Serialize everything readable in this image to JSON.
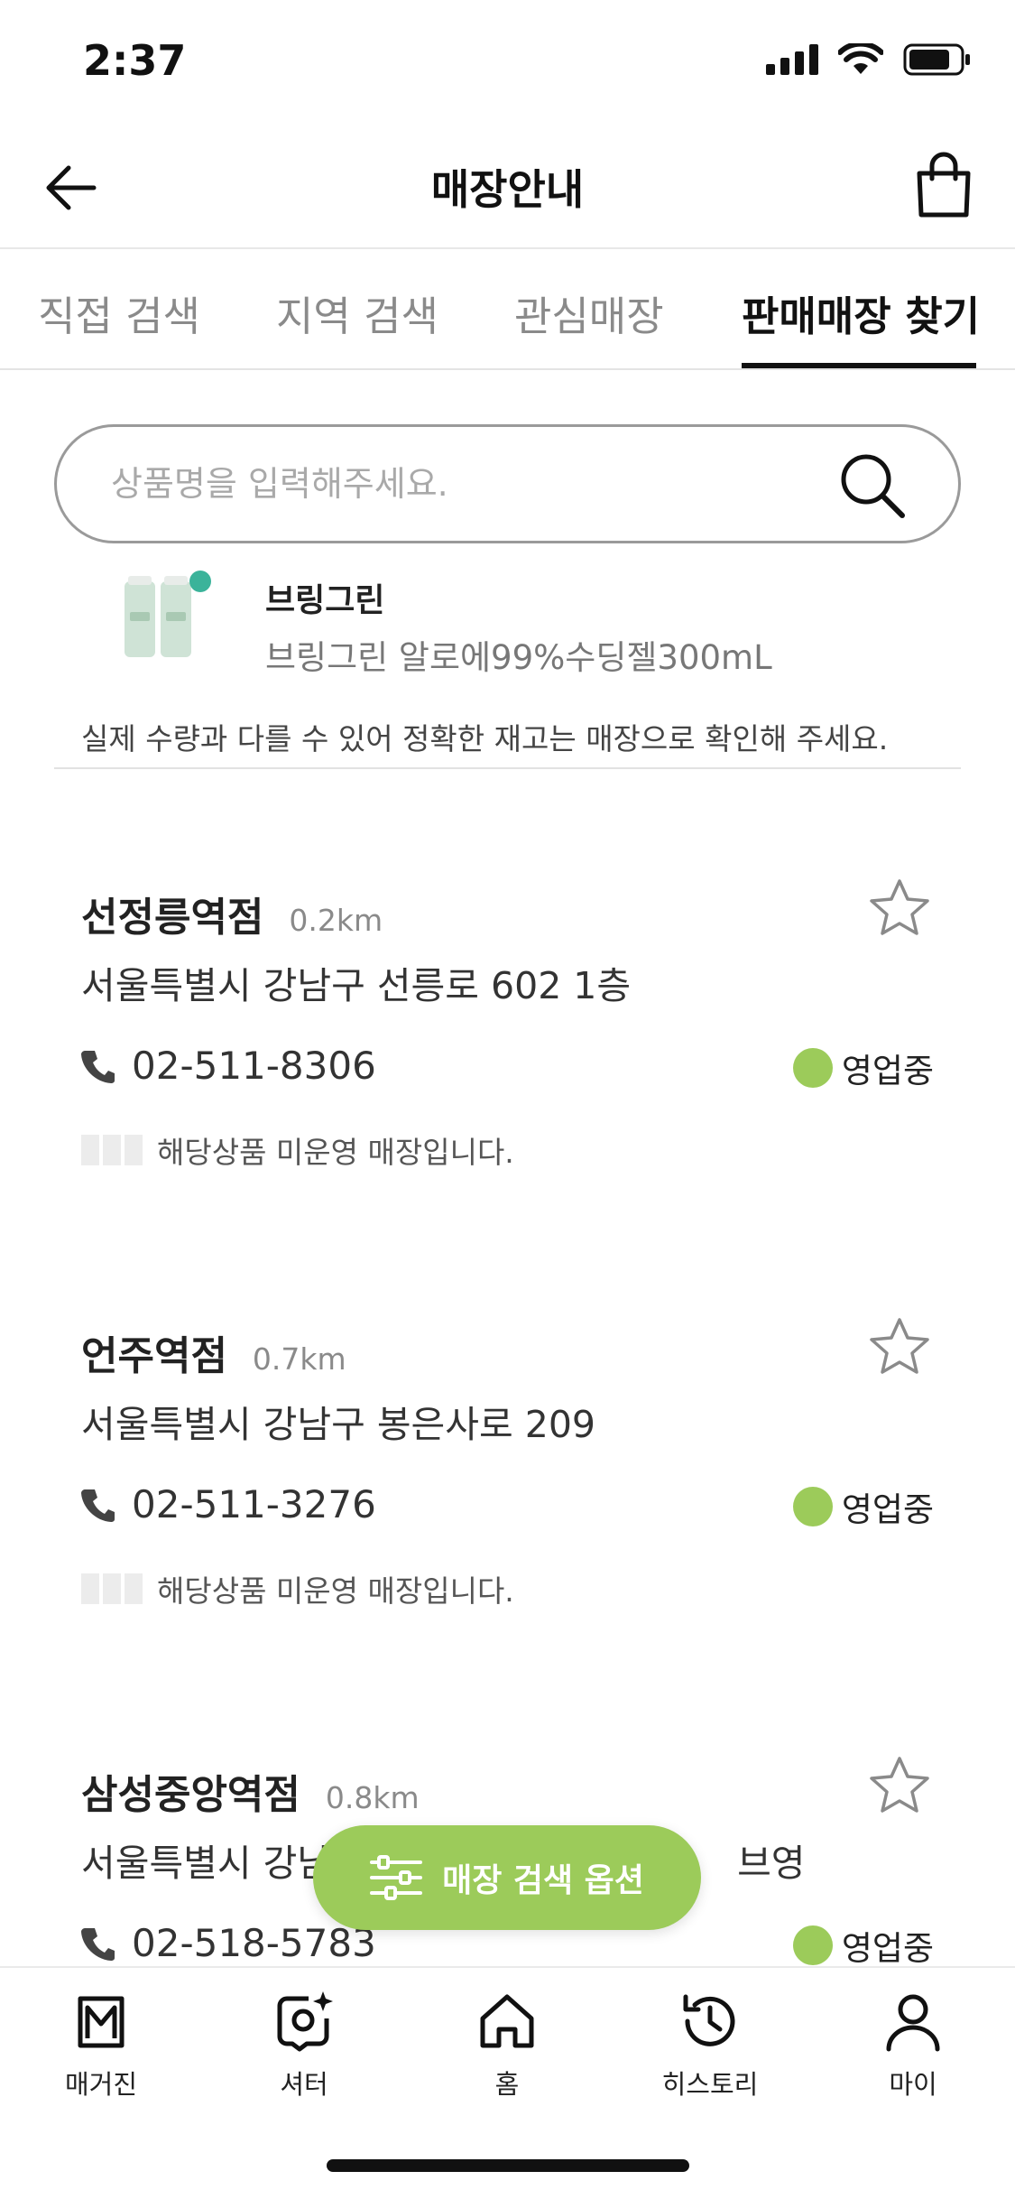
{
  "status_bar": {
    "time": "2:37"
  },
  "header": {
    "title": "매장안내"
  },
  "tabs": [
    {
      "label": "직접 검색"
    },
    {
      "label": "지역 검색"
    },
    {
      "label": "관심매장"
    },
    {
      "label": "판매매장 찾기"
    }
  ],
  "search": {
    "placeholder": "상품명을 입력해주세요."
  },
  "product": {
    "brand": "브링그린",
    "name": "브링그린 알로에99%수딩젤300mL"
  },
  "stock_note": "실제 수량과 다를 수 있어 정확한 재고는 매장으로 확인해 주세요.",
  "stores": [
    {
      "name": "선정릉역점",
      "distance": "0.2km",
      "address": "서울특별시 강남구 선릉로 602 1층",
      "phone": "02-511-8306",
      "status": "영업중",
      "stock_text": "해당상품 미운영 매장입니다."
    },
    {
      "name": "언주역점",
      "distance": "0.7km",
      "address": "서울특별시 강남구 봉은사로 209",
      "phone": "02-511-3276",
      "status": "영업중",
      "stock_text": "해당상품 미운영 매장입니다."
    },
    {
      "name": "삼성중앙역점",
      "distance": "0.8km",
      "address_start": "서울특별시 강남",
      "address_end": "브영",
      "phone": "02-518-5783",
      "status": "영업중"
    }
  ],
  "floating_button": {
    "label": "매장 검색 옵션"
  },
  "bottom_nav": [
    {
      "label": "매거진",
      "icon": "magazine-icon"
    },
    {
      "label": "셔터",
      "icon": "shutter-icon"
    },
    {
      "label": "홈",
      "icon": "home-icon"
    },
    {
      "label": "히스토리",
      "icon": "history-icon"
    },
    {
      "label": "마이",
      "icon": "person-icon"
    }
  ],
  "colors": {
    "accent_green": "#9ccb5a",
    "text_dark": "#222222",
    "text_muted": "#8a8a8a"
  }
}
